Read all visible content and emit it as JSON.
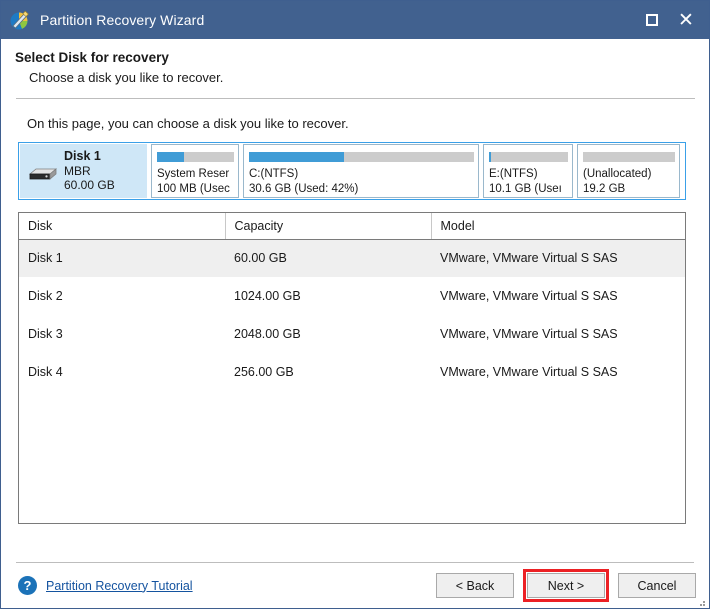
{
  "window": {
    "title": "Partition Recovery Wizard",
    "app_icon": "partition-wizard-icon",
    "maximize_label": "□",
    "close_label": "✕",
    "titlebar_color": "#41618f"
  },
  "header": {
    "title": "Select Disk for recovery",
    "subtitle": "Choose a disk you like to recover."
  },
  "intro": "On this page, you can choose a disk you like to recover.",
  "disk_map": {
    "selected_disk": {
      "name": "Disk 1",
      "scheme": "MBR",
      "capacity": "60.00 GB",
      "icon": "hard-disk-icon"
    },
    "accent_color": "#409cd6",
    "free_color": "#cccccc",
    "partitions": [
      {
        "label": "System Reser",
        "detail": "100 MB (Usec",
        "used_percent": 35
      },
      {
        "label": "C:(NTFS)",
        "detail": "30.6 GB (Used: 42%)",
        "used_percent": 42
      },
      {
        "label": "E:(NTFS)",
        "detail": "10.1 GB (Useı",
        "used_percent": 3
      },
      {
        "label": "(Unallocated)",
        "detail": "19.2 GB",
        "used_percent": 0
      }
    ]
  },
  "table": {
    "columns": [
      "Disk",
      "Capacity",
      "Model"
    ],
    "rows": [
      {
        "disk": "Disk 1",
        "capacity": "60.00 GB",
        "model": "VMware, VMware Virtual S SAS",
        "selected": true
      },
      {
        "disk": "Disk 2",
        "capacity": "1024.00 GB",
        "model": "VMware, VMware Virtual S SAS",
        "selected": false
      },
      {
        "disk": "Disk 3",
        "capacity": "2048.00 GB",
        "model": "VMware, VMware Virtual S SAS",
        "selected": false
      },
      {
        "disk": "Disk 4",
        "capacity": "256.00 GB",
        "model": "VMware, VMware Virtual S SAS",
        "selected": false
      }
    ]
  },
  "footer": {
    "help_icon": "question-mark-icon",
    "tutorial_link": "Partition Recovery Tutorial",
    "back_label": "< Back",
    "next_label": "Next >",
    "cancel_label": "Cancel",
    "highlight_color": "#ec2024"
  }
}
